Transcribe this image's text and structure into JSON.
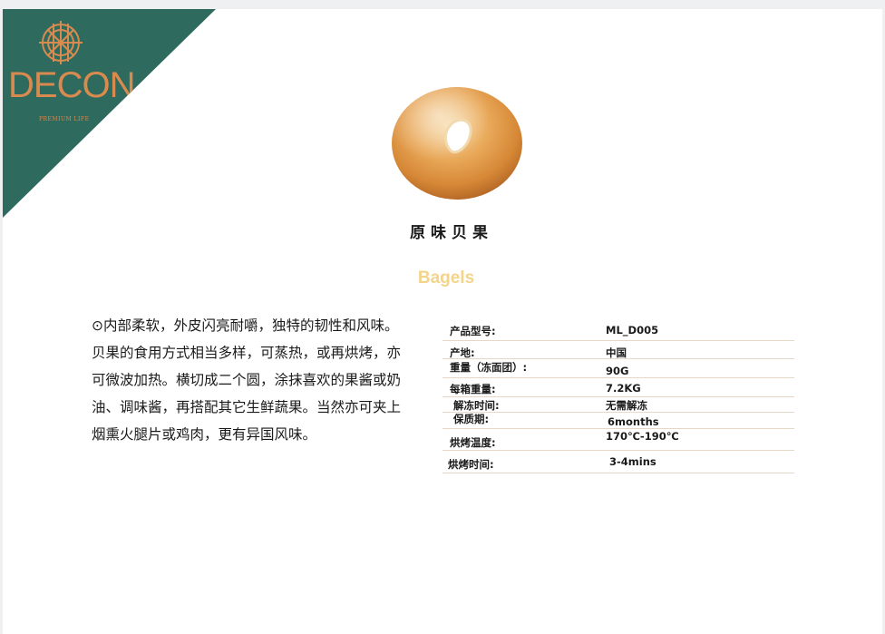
{
  "brand": {
    "name": "DECON",
    "tagline": "PREMIUM LIFE",
    "color": "#2e6a5e",
    "accent": "#d98b4f"
  },
  "product": {
    "name_cn": "原味贝果",
    "name_en": "Bagels",
    "description": [
      "⊙内部柔软，外皮闪亮耐嚼，独特的韧性和风味。",
      "贝果的食用方式相当多样，可蒸热，或再烘烤，亦可微波加热。横切成二个圆，涂抹喜欢的果酱或奶油、调味酱，再搭配其它生鲜蔬果。当然亦可夹上烟熏火腿片或鸡肉，更有异国风味。"
    ]
  },
  "specs": [
    {
      "label": "产品型号:",
      "value": "ML_D005"
    },
    {
      "label": "产地:",
      "value": "中国"
    },
    {
      "label": "重量（冻面团）:",
      "value": "90G"
    },
    {
      "label": "每箱重量:",
      "value": "7.2KG"
    },
    {
      "label": "解冻时间:",
      "value": "无需解冻"
    },
    {
      "label": "保质期:",
      "value": "6months"
    },
    {
      "label": "烘烤温度:",
      "value": "170℃-190℃"
    },
    {
      "label": "烘烤时间:",
      "value": "3-4mins"
    }
  ]
}
